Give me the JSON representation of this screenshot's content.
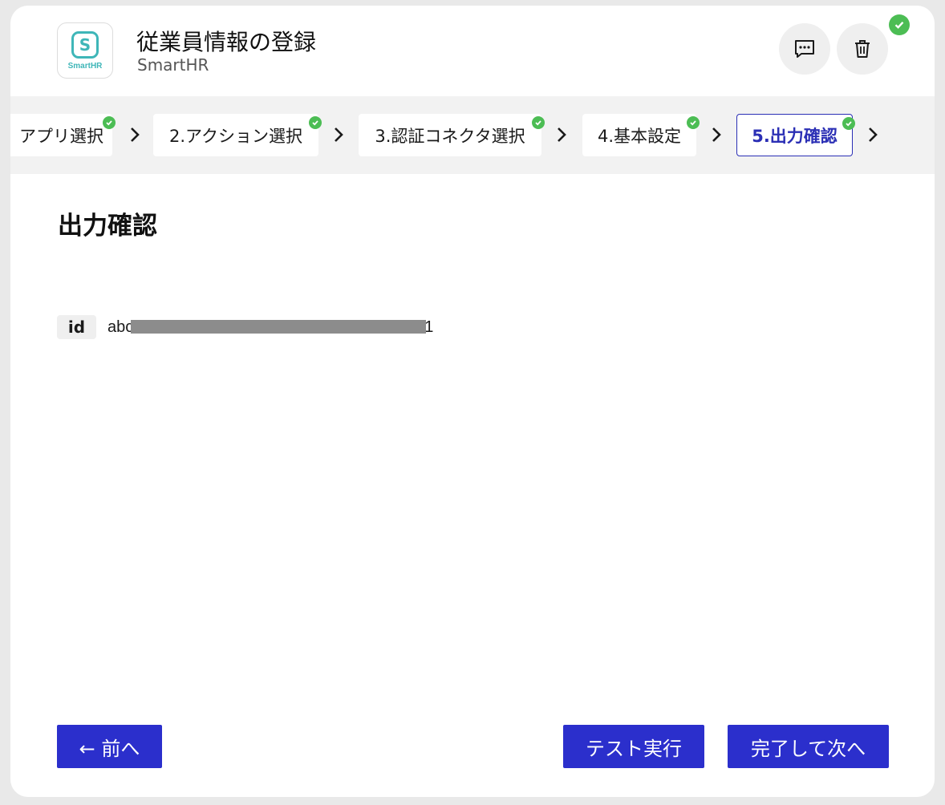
{
  "header": {
    "app_icon_text": "SmartHR",
    "title": "従業員情報の登録",
    "subtitle": "SmartHR",
    "actions": [
      {
        "name": "comment",
        "icon": "comment-icon"
      },
      {
        "name": "delete",
        "icon": "trash-icon"
      }
    ],
    "status_icon": "check-circle-icon"
  },
  "steps": [
    {
      "label": "アプリ選択",
      "done": true,
      "active": false
    },
    {
      "label": "2.アクション選択",
      "done": true,
      "active": false
    },
    {
      "label": "3.認証コネクタ選択",
      "done": true,
      "active": false
    },
    {
      "label": "4.基本設定",
      "done": true,
      "active": false
    },
    {
      "label": "5.出力確認",
      "done": true,
      "active": true
    }
  ],
  "main": {
    "section_title": "出力確認",
    "fields": [
      {
        "key": "id",
        "value": "abc",
        "value_tail": "1",
        "redacted": true
      }
    ]
  },
  "footer": {
    "prev_label": "← 前へ",
    "test_label": "テスト実行",
    "next_label": "完了して次へ"
  },
  "colors": {
    "primary": "#2b2fcc",
    "success": "#4cbd54",
    "brand": "#3fb6b8"
  }
}
